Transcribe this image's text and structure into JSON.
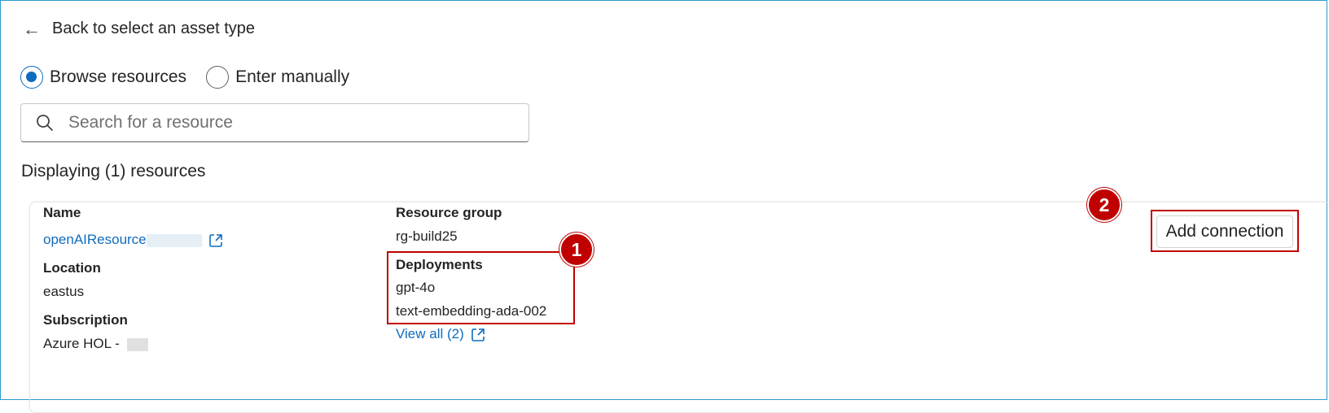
{
  "nav": {
    "back_label": "Back to select an asset type"
  },
  "source_options": [
    {
      "label": "Browse resources",
      "selected": true
    },
    {
      "label": "Enter manually",
      "selected": false
    }
  ],
  "search": {
    "placeholder": "Search for a resource",
    "value": ""
  },
  "results": {
    "count_text": "Displaying (1) resources"
  },
  "resource": {
    "name_label": "Name",
    "name_value": "openAIResource",
    "location_label": "Location",
    "location_value": "eastus",
    "subscription_label": "Subscription",
    "subscription_value": "Azure HOL - ",
    "resource_group_label": "Resource group",
    "resource_group_value": "rg-build25",
    "deployments_label": "Deployments",
    "deployments": [
      "gpt-4o",
      "text-embedding-ada-002"
    ],
    "view_all_label": "View all (2)"
  },
  "actions": {
    "add_connection_label": "Add connection"
  },
  "annotations": {
    "marker1": "1",
    "marker2": "2"
  },
  "colors": {
    "accent": "#0f6cbd",
    "annotation_red": "#c00000",
    "frame_border": "#2f9ad0"
  }
}
